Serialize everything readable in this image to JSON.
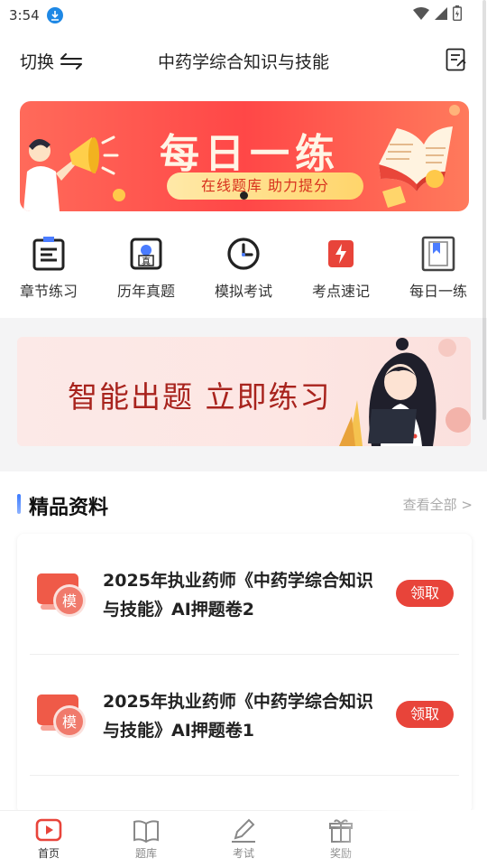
{
  "status_bar": {
    "time": "3:54"
  },
  "header": {
    "switch_label": "切换",
    "title": "中药学综合知识与技能"
  },
  "banner": {
    "title": "每日一练",
    "subtitle": "在线题库  助力提分"
  },
  "quick_nav": [
    {
      "label": "章节练习",
      "icon": "chapter-list-icon"
    },
    {
      "label": "历年真题",
      "icon": "past-exam-icon"
    },
    {
      "label": "模拟考试",
      "icon": "clock-icon"
    },
    {
      "label": "考点速记",
      "icon": "flash-note-icon"
    },
    {
      "label": "每日一练",
      "icon": "bookmark-book-icon"
    }
  ],
  "promo": {
    "text": "智能出题  立即练习"
  },
  "section": {
    "title": "精品资料",
    "view_all": "查看全部 >"
  },
  "materials": [
    {
      "badge": "模",
      "title": "2025年执业药师《中药学综合知识与技能》AI押题卷2",
      "action": "领取"
    },
    {
      "badge": "模",
      "title": "2025年执业药师《中药学综合知识与技能》AI押题卷1",
      "action": "领取"
    }
  ],
  "tabs": [
    {
      "label": "首页",
      "icon": "home-play-icon",
      "active": true
    },
    {
      "label": "题库",
      "icon": "book-icon",
      "active": false
    },
    {
      "label": "考试",
      "icon": "pen-icon",
      "active": false
    },
    {
      "label": "奖励",
      "icon": "gift-icon",
      "active": false
    },
    {
      "label": "",
      "icon": "user-icon",
      "active": false
    }
  ],
  "colors": {
    "accent": "#e8443a",
    "banner_red": "#ff4747",
    "promo_text": "#a8231d",
    "section_bar": "#3b7bff"
  }
}
